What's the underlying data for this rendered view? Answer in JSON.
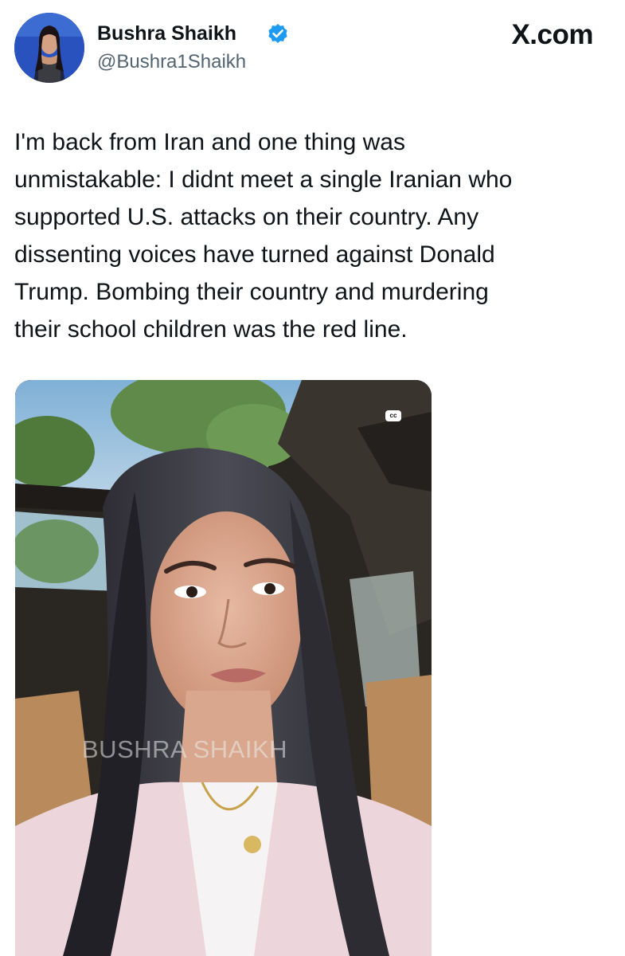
{
  "header": {
    "display_name": "Bushra Shaikh",
    "handle": "@Bushra1Shaikh",
    "verified_icon": "verified-badge-icon",
    "site_label": "X.com"
  },
  "tweet": {
    "text_lines": [
      "I'm back from Iran and one thing was",
      "unmistakable: I didnt meet a single Iranian who",
      "supported U.S. attacks on their country. Any",
      "dissenting voices have turned against Donald",
      "Trump. Bombing their country and murdering",
      "their school children was the red line."
    ]
  },
  "media": {
    "type": "video",
    "cc_label": "cc",
    "watermark": "BUSHRA SHAIKH"
  },
  "colors": {
    "text_primary": "#0f1419",
    "text_secondary": "#536471",
    "verified_blue": "#1d9bf0"
  }
}
